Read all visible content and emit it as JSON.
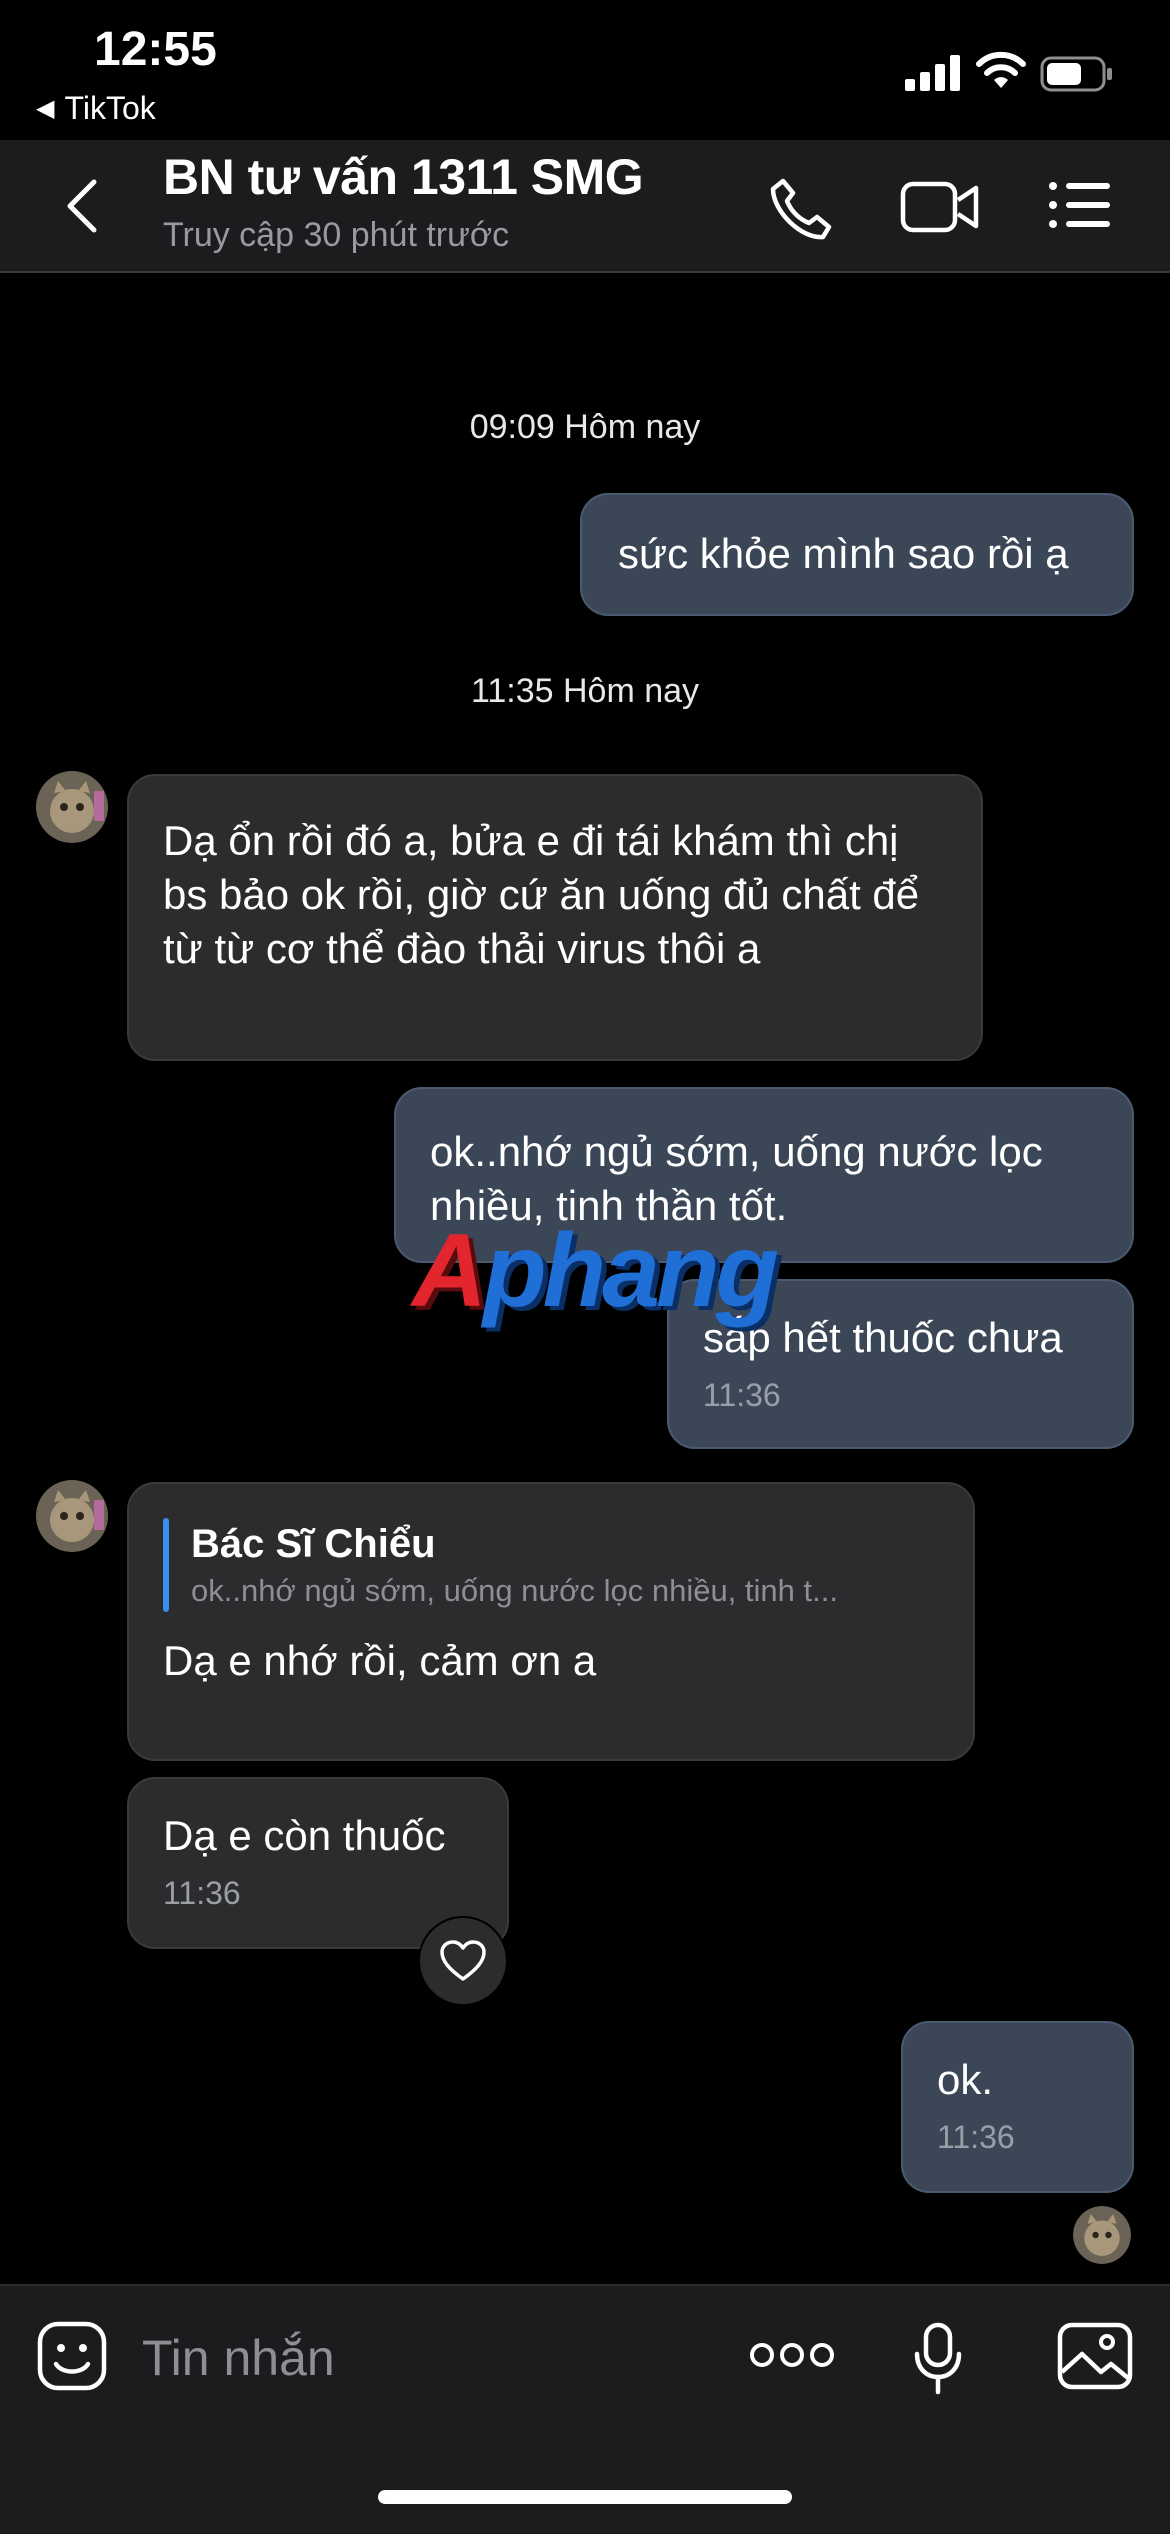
{
  "status_bar": {
    "time": "12:55",
    "back_app": "TikTok"
  },
  "header": {
    "title": "BN tư vấn 1311 SMG",
    "subtitle": "Truy cập 30 phút trước"
  },
  "messages": [
    {
      "kind": "timestamp",
      "text": "09:09 Hôm nay"
    },
    {
      "kind": "sent",
      "text": "sức khỏe mình sao rồi ạ"
    },
    {
      "kind": "timestamp",
      "text": "11:35 Hôm nay"
    },
    {
      "kind": "received",
      "text": "Dạ ổn rồi đó a, bửa e đi tái khám thì chị bs bảo ok rồi, giờ cứ ăn uống đủ chất để từ từ cơ thể đào thải virus thôi a"
    },
    {
      "kind": "sent",
      "text": "ok..nhớ ngủ sớm, uống nước lọc nhiều, tinh thần tốt."
    },
    {
      "kind": "sent",
      "text": "sắp hết thuốc chưa",
      "time": "11:36"
    },
    {
      "kind": "received",
      "quote_name": "Bác Sĩ Chiểu",
      "quote_text": "ok..nhớ ngủ sớm, uống nước lọc nhiều, tinh t...",
      "text": "Dạ e nhớ rồi, cảm ơn a"
    },
    {
      "kind": "received",
      "text": "Dạ e còn thuốc",
      "time": "11:36"
    },
    {
      "kind": "sent",
      "text": "ok.",
      "time": "11:36"
    }
  ],
  "watermark": {
    "first": "A",
    "rest": "phang"
  },
  "input": {
    "placeholder": "Tin nhắn"
  },
  "colors": {
    "sent_bubble": "#3b4757",
    "received_bubble": "#2c2c2e",
    "quote_bar": "#3a8ef0",
    "background": "#000000"
  }
}
